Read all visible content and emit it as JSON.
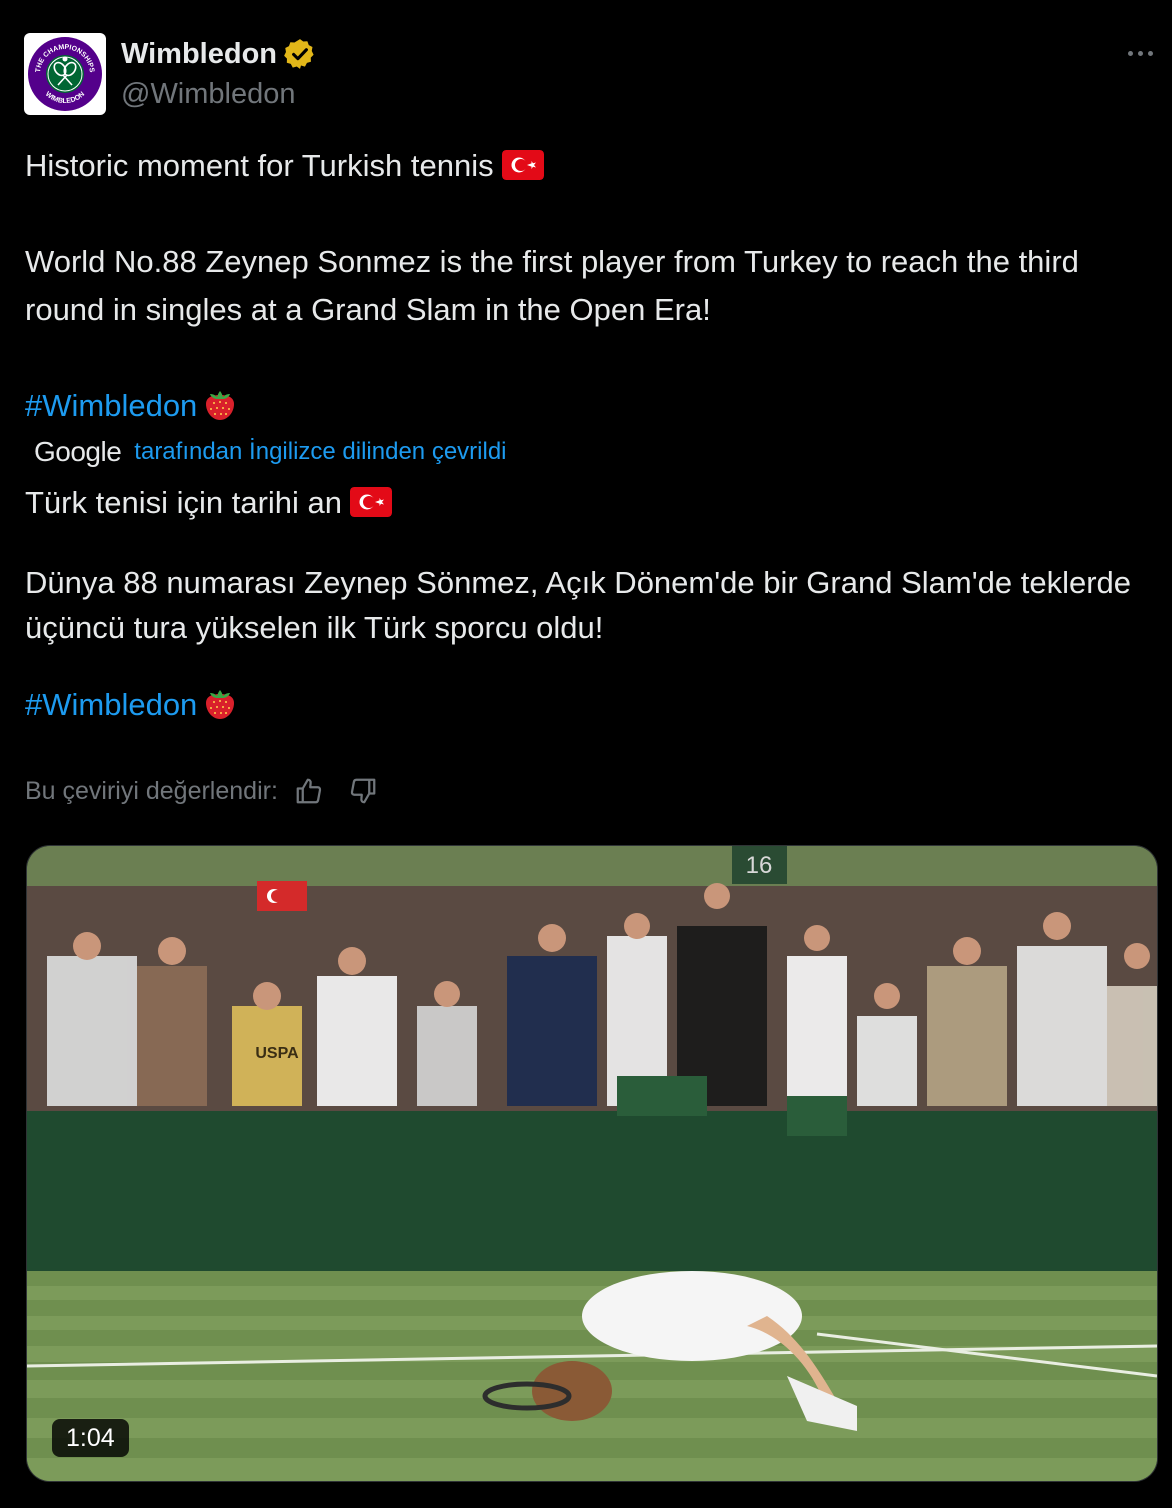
{
  "tweet": {
    "author": {
      "name": "Wimbledon",
      "handle": "@Wimbledon",
      "avatar_text_top": "THE CHAMPIONSHIPS",
      "avatar_text_bottom": "WIMBLEDON",
      "verified": true
    },
    "original": {
      "line1": "Historic moment for Turkish tennis",
      "paragraph2": "World No.88 Zeynep Sonmez is the first player from Turkey to reach the third round in singles at a Grand Slam in the Open Era!",
      "hashtag": "#Wimbledon"
    },
    "translation": {
      "provider": "Google",
      "note": "tarafından İngilizce dilinden çevrildi",
      "line1": "Türk tenisi için tarihi an",
      "paragraph2": "Dünya 88 numarası Zeynep Sönmez, Açık Dönem'de bir Grand Slam'de teklerde üçüncü tura yükselen ilk Türk sporcu oldu!",
      "hashtag": "#Wimbledon"
    },
    "rating": {
      "label": "Bu çeviriyi değerlendir:"
    },
    "media": {
      "duration": "1:04",
      "court_number": "16",
      "shirt_text": "USPA"
    }
  },
  "colors": {
    "background": "#000000",
    "text": "#e7e9ea",
    "muted": "#71767b",
    "link": "#1d9bf0",
    "wimbledon_purple": "#54008b",
    "wimbledon_green": "#006633",
    "verified_gold": "#e2b719"
  },
  "icons": [
    "verified-badge-icon",
    "more-icon",
    "turkey-flag-icon",
    "strawberry-icon",
    "thumbs-up-icon",
    "thumbs-down-icon"
  ]
}
